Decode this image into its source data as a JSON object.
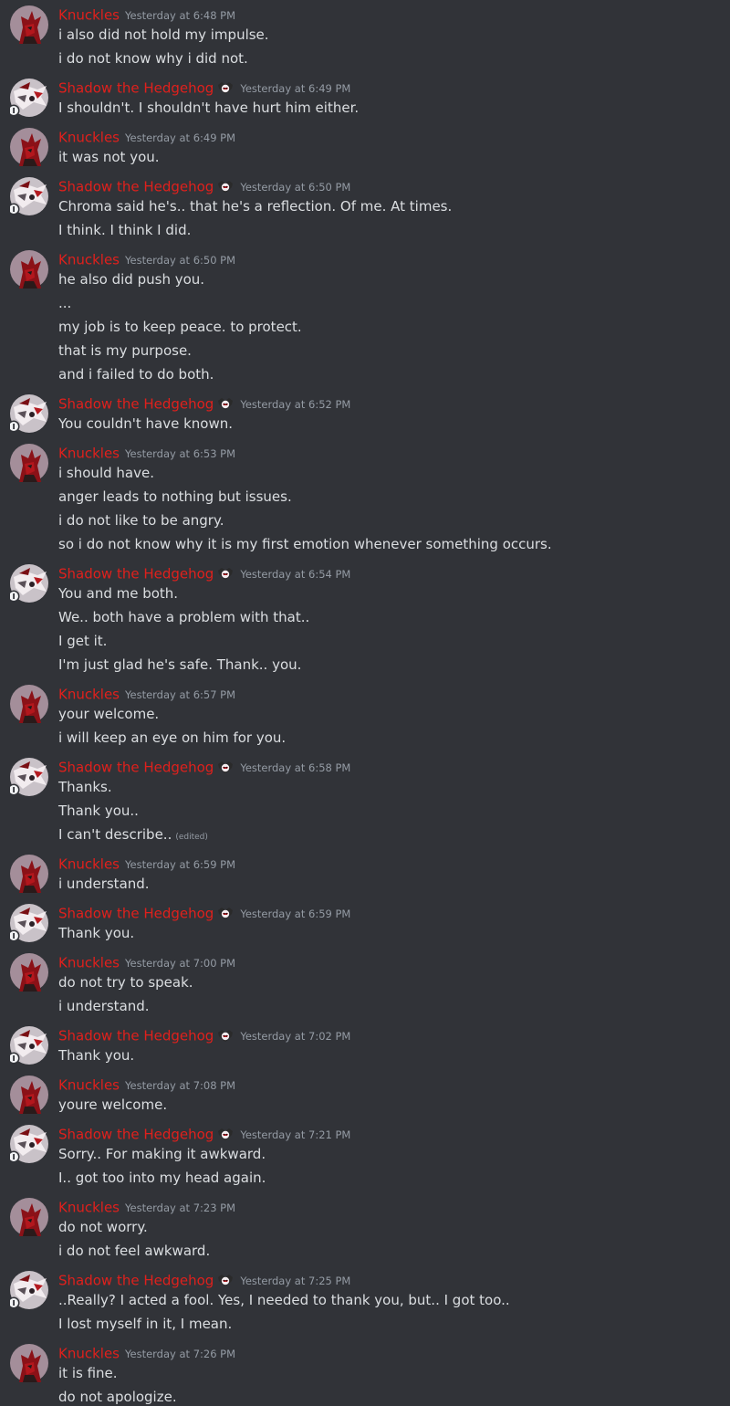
{
  "colors": {
    "background": "#313338",
    "author": "#e0201c",
    "text": "#dbdee1",
    "muted": "#949ba4"
  },
  "messages": [
    {
      "author": "Knuckles",
      "role": "knuckles",
      "time": "Yesterday at 6:48 PM",
      "lines": [
        "i also did not hold my impulse.",
        "i do not know why i did not."
      ]
    },
    {
      "author": "Shadow the Hedgehog",
      "role": "shadow",
      "time": "Yesterday at 6:49 PM",
      "lines": [
        "I shouldn't. I shouldn't have hurt him either."
      ]
    },
    {
      "author": "Knuckles",
      "role": "knuckles",
      "time": "Yesterday at 6:49 PM",
      "lines": [
        "it was not you."
      ]
    },
    {
      "author": "Shadow the Hedgehog",
      "role": "shadow",
      "time": "Yesterday at 6:50 PM",
      "lines": [
        "Chroma said he's.. that he's a reflection. Of me. At times.",
        "I think. I think I did."
      ]
    },
    {
      "author": "Knuckles",
      "role": "knuckles",
      "time": "Yesterday at 6:50 PM",
      "lines": [
        "he also did push you.",
        "...",
        "my job is to keep peace. to protect.",
        "that is my purpose.",
        "and i failed to do both."
      ]
    },
    {
      "author": "Shadow the Hedgehog",
      "role": "shadow",
      "time": "Yesterday at 6:52 PM",
      "lines": [
        "You couldn't have known."
      ]
    },
    {
      "author": "Knuckles",
      "role": "knuckles",
      "time": "Yesterday at 6:53 PM",
      "lines": [
        "i should have.",
        "anger leads to nothing but issues.",
        "i do not like to be angry.",
        "so i do not know why it is my first emotion whenever something occurs."
      ]
    },
    {
      "author": "Shadow the Hedgehog",
      "role": "shadow",
      "time": "Yesterday at 6:54 PM",
      "lines": [
        "You and me both.",
        "We.. both have a problem with that..",
        "I get it.",
        "I'm just glad he's safe. Thank.. you."
      ]
    },
    {
      "author": "Knuckles",
      "role": "knuckles",
      "time": "Yesterday at 6:57 PM",
      "lines": [
        "your welcome.",
        "i will keep an eye on him for you."
      ]
    },
    {
      "author": "Shadow the Hedgehog",
      "role": "shadow",
      "time": "Yesterday at 6:58 PM",
      "lines": [
        "Thanks.",
        "Thank you..",
        "I can't describe.."
      ],
      "edited_label": "(edited)"
    },
    {
      "author": "Knuckles",
      "role": "knuckles",
      "time": "Yesterday at 6:59 PM",
      "lines": [
        "i understand."
      ]
    },
    {
      "author": "Shadow the Hedgehog",
      "role": "shadow",
      "time": "Yesterday at 6:59 PM",
      "lines": [
        "Thank you."
      ]
    },
    {
      "author": "Knuckles",
      "role": "knuckles",
      "time": "Yesterday at 7:00 PM",
      "lines": [
        "do not try to speak.",
        "i understand."
      ]
    },
    {
      "author": "Shadow the Hedgehog",
      "role": "shadow",
      "time": "Yesterday at 7:02 PM",
      "lines": [
        "Thank you."
      ]
    },
    {
      "author": "Knuckles",
      "role": "knuckles",
      "time": "Yesterday at 7:08 PM",
      "lines": [
        "youre welcome."
      ]
    },
    {
      "author": "Shadow the Hedgehog",
      "role": "shadow",
      "time": "Yesterday at 7:21 PM",
      "lines": [
        "Sorry.. For making it awkward.",
        "I.. got too into my head again."
      ]
    },
    {
      "author": "Knuckles",
      "role": "knuckles",
      "time": "Yesterday at 7:23 PM",
      "lines": [
        "do not worry.",
        "i do not feel awkward."
      ]
    },
    {
      "author": "Shadow the Hedgehog",
      "role": "shadow",
      "time": "Yesterday at 7:25 PM",
      "lines": [
        "..Really? I acted a fool. Yes, I needed to thank you, but.. I got too..",
        "I lost myself in it, I mean."
      ]
    },
    {
      "author": "Knuckles",
      "role": "knuckles",
      "time": "Yesterday at 7:26 PM",
      "lines": [
        "it is fine.",
        "do not apologize."
      ]
    }
  ]
}
